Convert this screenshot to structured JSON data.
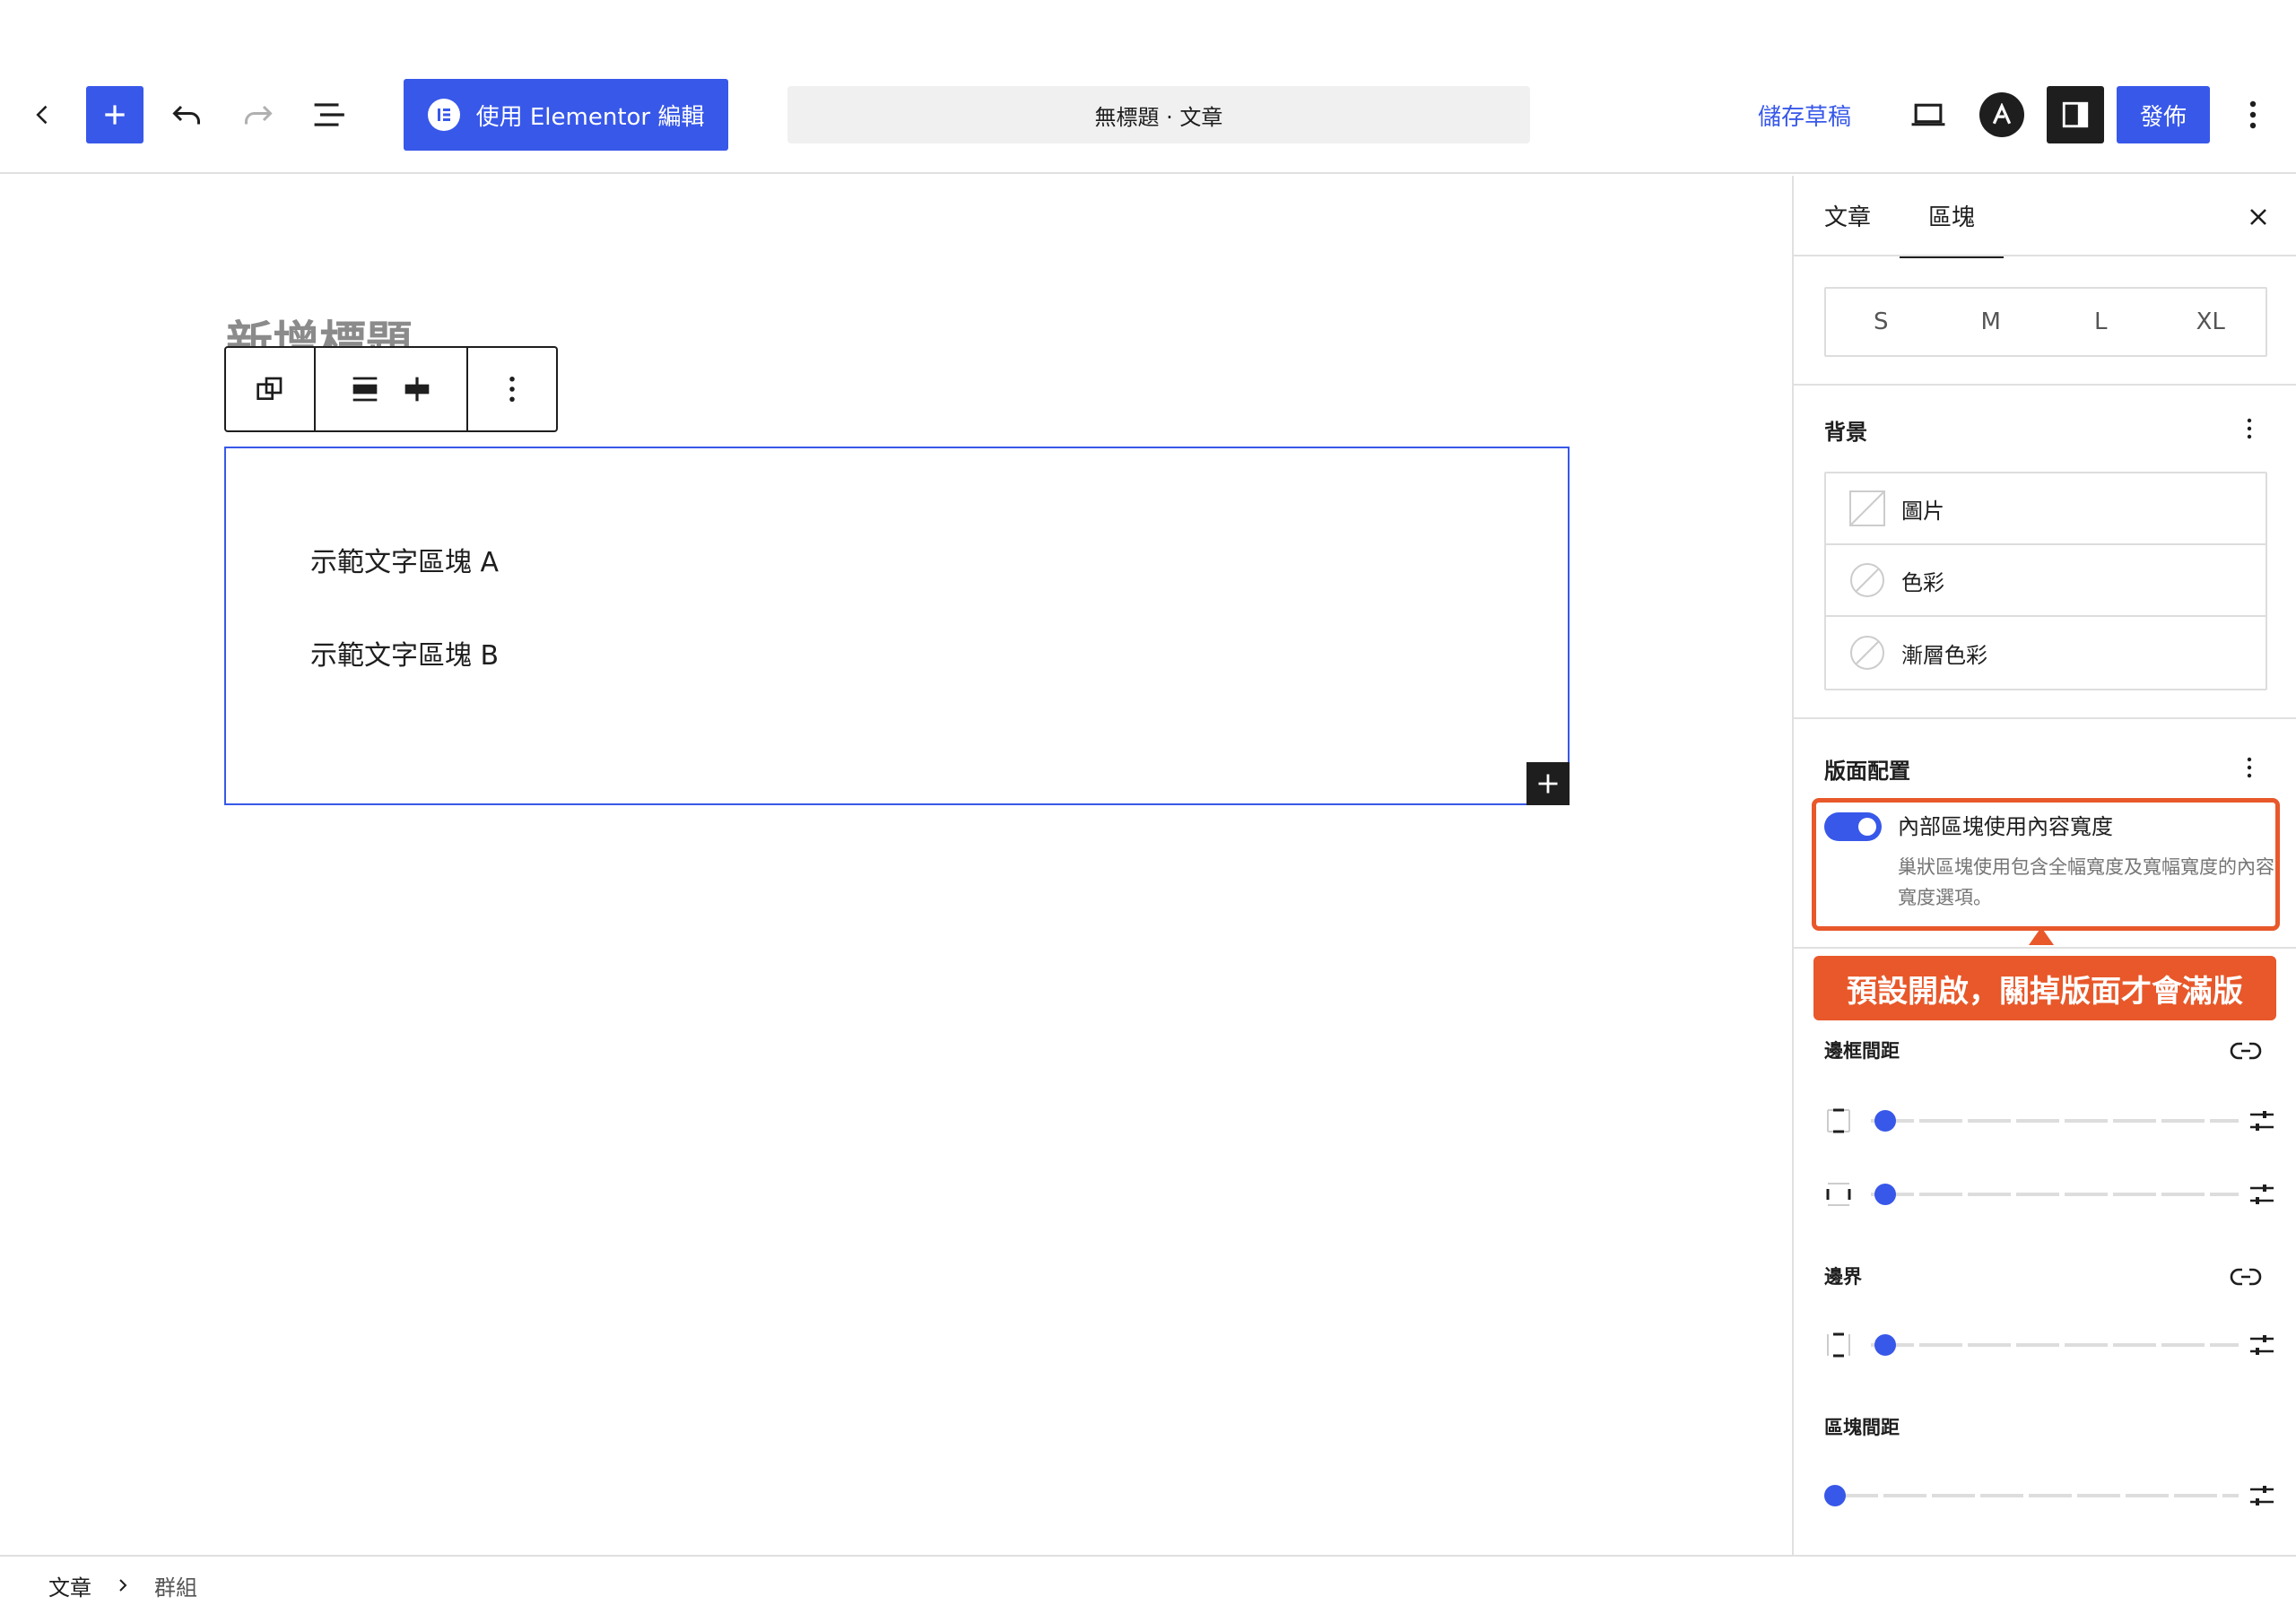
{
  "header": {
    "elementor_label": "使用 Elementor 編輯",
    "doc_title": "無標題 · 文章",
    "save_draft": "儲存草稿",
    "publish": "發佈"
  },
  "editor": {
    "post_title": "新增標題",
    "paragraphs": [
      "示範文字區塊 A",
      "示範文字區塊 B"
    ]
  },
  "sidebar": {
    "tabs": [
      "文章",
      "區塊"
    ],
    "sizes": [
      "S",
      "M",
      "L",
      "XL"
    ],
    "background": {
      "title": "背景",
      "items": [
        "圖片",
        "色彩",
        "漸層色彩"
      ]
    },
    "layout": {
      "title": "版面配置",
      "toggle_label": "內部區塊使用內容寬度",
      "toggle_help": "巢狀區塊使用包含全幅寬度及寬幅寬度的內容寬度選項。",
      "toggle_on": true
    },
    "callout": "預設開啟，關掉版面才會滿版",
    "padding": {
      "title": "邊框間距"
    },
    "margin": {
      "title": "邊界"
    },
    "block_spacing": {
      "title": "區塊間距"
    }
  },
  "breadcrumb": [
    "文章",
    "群組"
  ],
  "colors": {
    "accent": "#3858e9",
    "highlight": "#e8582a",
    "dark": "#1e1e1e"
  }
}
